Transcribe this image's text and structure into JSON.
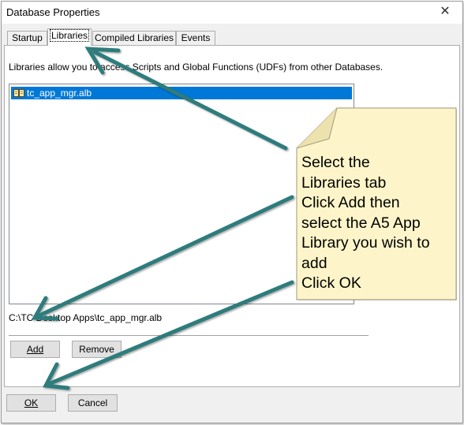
{
  "window": {
    "title": "Database Properties",
    "close_label": "✕"
  },
  "tabs": [
    {
      "label": "Startup"
    },
    {
      "label": "Libraries",
      "active": true
    },
    {
      "label": "Compiled Libraries"
    },
    {
      "label": "Events"
    }
  ],
  "libraries": {
    "description": "Libraries allow you to access Scripts and Global Functions (UDFs) from other Databases.",
    "items": [
      {
        "name": "tc_app_mgr.alb",
        "icon": "book-icon",
        "selected": true
      }
    ],
    "selected_path": "C:\\TC Desktop Apps\\tc_app_mgr.alb",
    "add_label": "Add",
    "remove_label": "Remove"
  },
  "footer": {
    "ok_label": "OK",
    "cancel_label": "Cancel"
  },
  "callout": {
    "lines": [
      "Select the",
      "Libraries tab",
      "Click Add then",
      "select the A5 App",
      "Library you wish to",
      "add",
      "Click OK"
    ]
  },
  "colors": {
    "selection": "#0078d7",
    "callout_fill": "#fdf5c9",
    "callout_border": "#9e9a7c",
    "arrow": "#2f7c7c"
  }
}
